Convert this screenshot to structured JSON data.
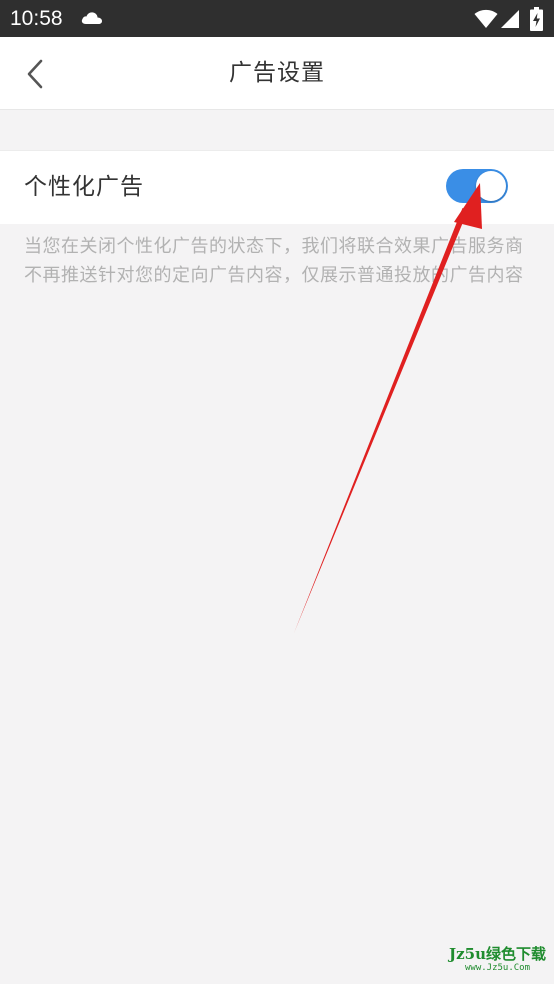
{
  "status_bar": {
    "time": "10:58",
    "icons": [
      "cloud-icon",
      "wifi-icon",
      "signal-icon",
      "battery-charging-icon"
    ]
  },
  "nav": {
    "back_icon": "chevron-left-icon",
    "title": "广告设置"
  },
  "setting": {
    "label": "个性化广告",
    "toggle_on": true,
    "toggle_color": "#3a8ee6",
    "description": "当您在关闭个性化广告的状态下，我们将联合效果广告服务商不再推送针对您的定向广告内容，仅展示普通投放的广告内容"
  },
  "annotation": {
    "type": "arrow",
    "color": "#e02020"
  },
  "watermark": {
    "main": "Jz5u绿色下载",
    "sub": "www.Jz5u.Com"
  }
}
